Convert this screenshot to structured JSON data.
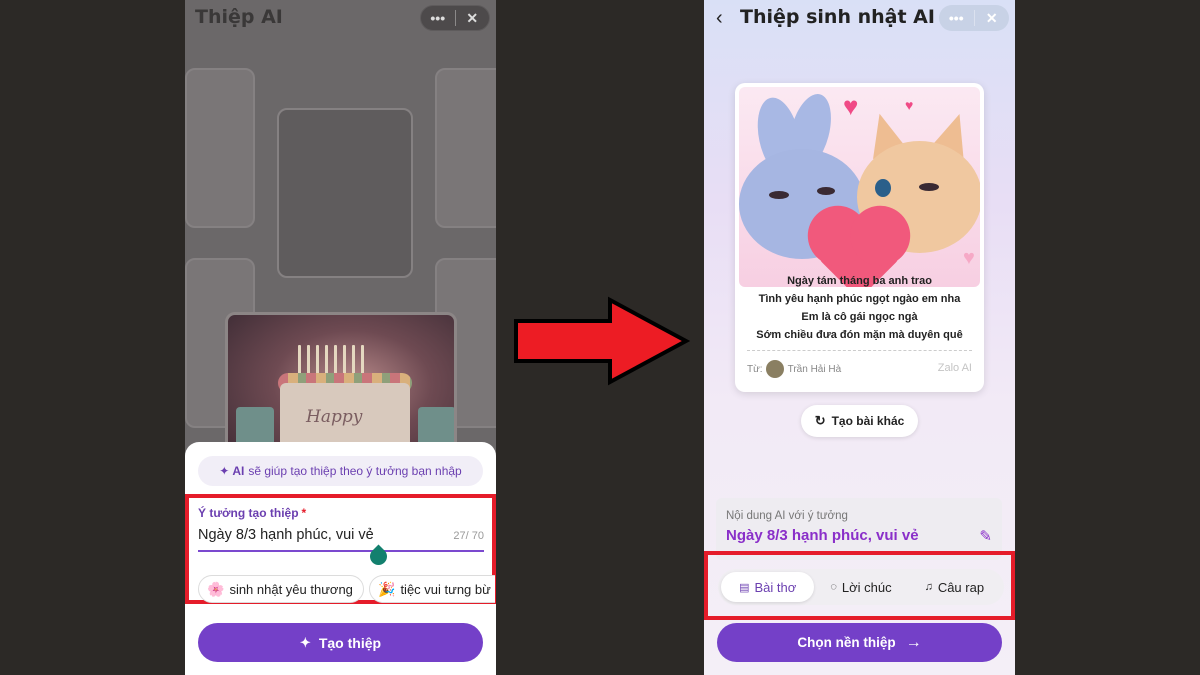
{
  "colors": {
    "accent": "#7440c8",
    "highlight_box": "#e51c2a",
    "idea_text": "#8a2fc9"
  },
  "left_screen": {
    "title": "Thiệp AI",
    "capsule": {
      "more_icon": "more-dots-icon",
      "close_icon": "close-icon"
    },
    "ai_hint": {
      "icon": "sparkle-icon",
      "bold": "AI",
      "text": "sẽ giúp tạo thiệp theo ý tưởng bạn nhập"
    },
    "idea_field": {
      "label": "Ý tưởng tạo thiệp",
      "required_mark": "*",
      "value": "Ngày 8/3 hạnh phúc, vui vẻ",
      "counter": "27/ 70"
    },
    "suggestion_chips": [
      {
        "icon": "flower-emoji",
        "emoji": "🌸",
        "label": "sinh nhật yêu thương"
      },
      {
        "icon": "party-emoji",
        "emoji": "🎉",
        "label": "tiệc vui tưng bừ"
      }
    ],
    "create_button": {
      "icon": "sparkle-icon",
      "label": "Tạo thiệp"
    }
  },
  "right_screen": {
    "title": "Thiệp sinh nhật AI",
    "back_icon": "chevron-left-icon",
    "card": {
      "poem_lines": [
        "Ngày tám tháng ba anh trao",
        "Tình yêu hạnh phúc ngọt ngào em nha",
        "Em là cô gái ngọc ngà",
        "Sớm chiều đưa đón mặn mà duyên quê"
      ],
      "from_label": "Từ:",
      "from_name": "Trần Hải Hà",
      "brand": "Zalo AI"
    },
    "regen_button": {
      "icon": "refresh-icon",
      "label": "Tạo bài khác"
    },
    "content": {
      "label": "Nội dung AI với ý tưởng",
      "value": "Ngày 8/3 hạnh phúc, vui vẻ",
      "edit_icon": "magic-wand-icon"
    },
    "tabs": [
      {
        "icon": "document-icon",
        "label": "Bài thơ",
        "active": true
      },
      {
        "icon": "chat-icon",
        "label": "Lời chúc",
        "active": false
      },
      {
        "icon": "music-note-icon",
        "label": "Câu rap",
        "active": false
      }
    ],
    "choose_button": {
      "label": "Chọn nền thiệp",
      "icon": "arrow-right-icon"
    }
  }
}
